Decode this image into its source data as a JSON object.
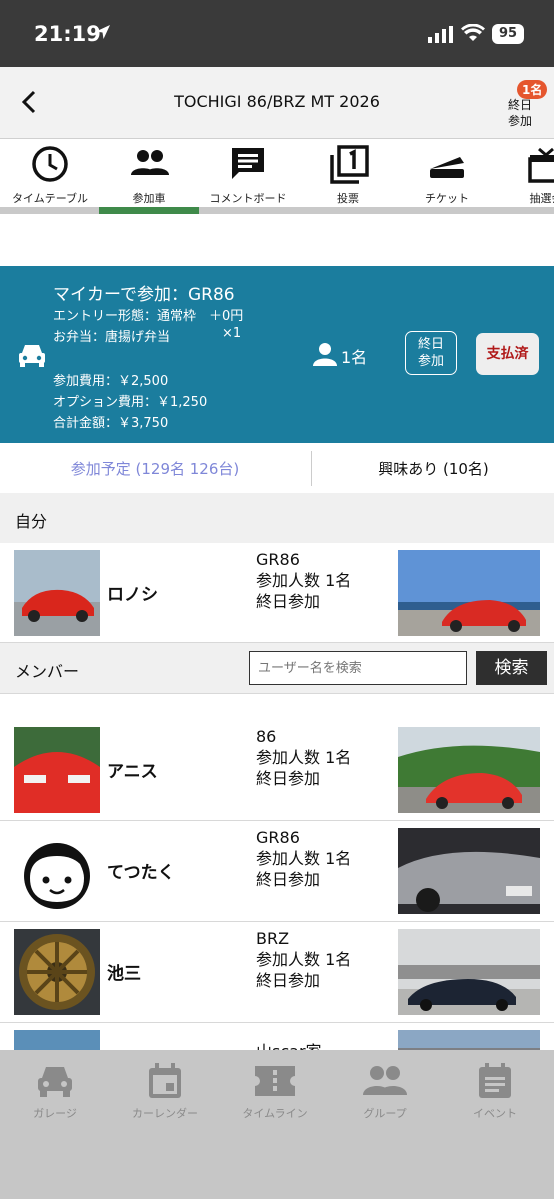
{
  "status_bar": {
    "time": "21:19",
    "battery": "95"
  },
  "header": {
    "title": "TOCHIGI 86/BRZ MT 2026",
    "badge": "1名",
    "right_line1": "終日",
    "right_line2": "参加"
  },
  "tabs": [
    {
      "label": "タイムテーブル",
      "icon": "clock-icon"
    },
    {
      "label": "参加車",
      "icon": "people-icon",
      "active": true
    },
    {
      "label": "コメントボード",
      "icon": "comment-icon"
    },
    {
      "label": "投票",
      "icon": "vote-icon"
    },
    {
      "label": "チケット",
      "icon": "ticket-icon"
    },
    {
      "label": "抽選会",
      "icon": "gift-icon"
    }
  ],
  "entry_card": {
    "title": "マイカーで参加：GR86",
    "entry_type": "エントリー形態：通常枠　＋0円",
    "bento": "お弁当：唐揚げ弁当",
    "bento_qty": "×1",
    "participants": "1名",
    "allday_line1": "終日",
    "allday_line2": "参加",
    "paid_label": "支払済",
    "fee": "参加費用：￥2,500",
    "option_fee": "オプション費用：￥1,250",
    "total": "合計金額：￥3,750",
    "bg_color": "#1b7d9e"
  },
  "summary": {
    "going": "参加予定 (129名 126台)",
    "interested": "興味あり (10名)"
  },
  "self_section": {
    "label": "自分"
  },
  "self_row": {
    "name": "ロノシ",
    "car": "GR86",
    "count": "参加人数 1名",
    "allday": "終日参加"
  },
  "member_section": {
    "label": "メンバー",
    "search_placeholder": "ユーザー名を検索",
    "search_button": "検索"
  },
  "members": [
    {
      "name": "アニス",
      "car": "86",
      "count": "参加人数 1名",
      "allday": "終日参加"
    },
    {
      "name": "てつたく",
      "car": "GR86",
      "count": "参加人数 1名",
      "allday": "終日参加"
    },
    {
      "name": "池三",
      "car": "BRZ",
      "count": "参加人数 1名",
      "allday": "終日参加"
    },
    {
      "name": "",
      "car": "山scar家",
      "count": "",
      "allday": ""
    }
  ],
  "bottom_nav": [
    {
      "label": "ガレージ",
      "icon": "car-icon"
    },
    {
      "label": "カーレンダー",
      "icon": "calendar-icon"
    },
    {
      "label": "タイムライン",
      "icon": "ticket-icon"
    },
    {
      "label": "グループ",
      "icon": "group-icon"
    },
    {
      "label": "イベント",
      "icon": "event-icon"
    }
  ]
}
